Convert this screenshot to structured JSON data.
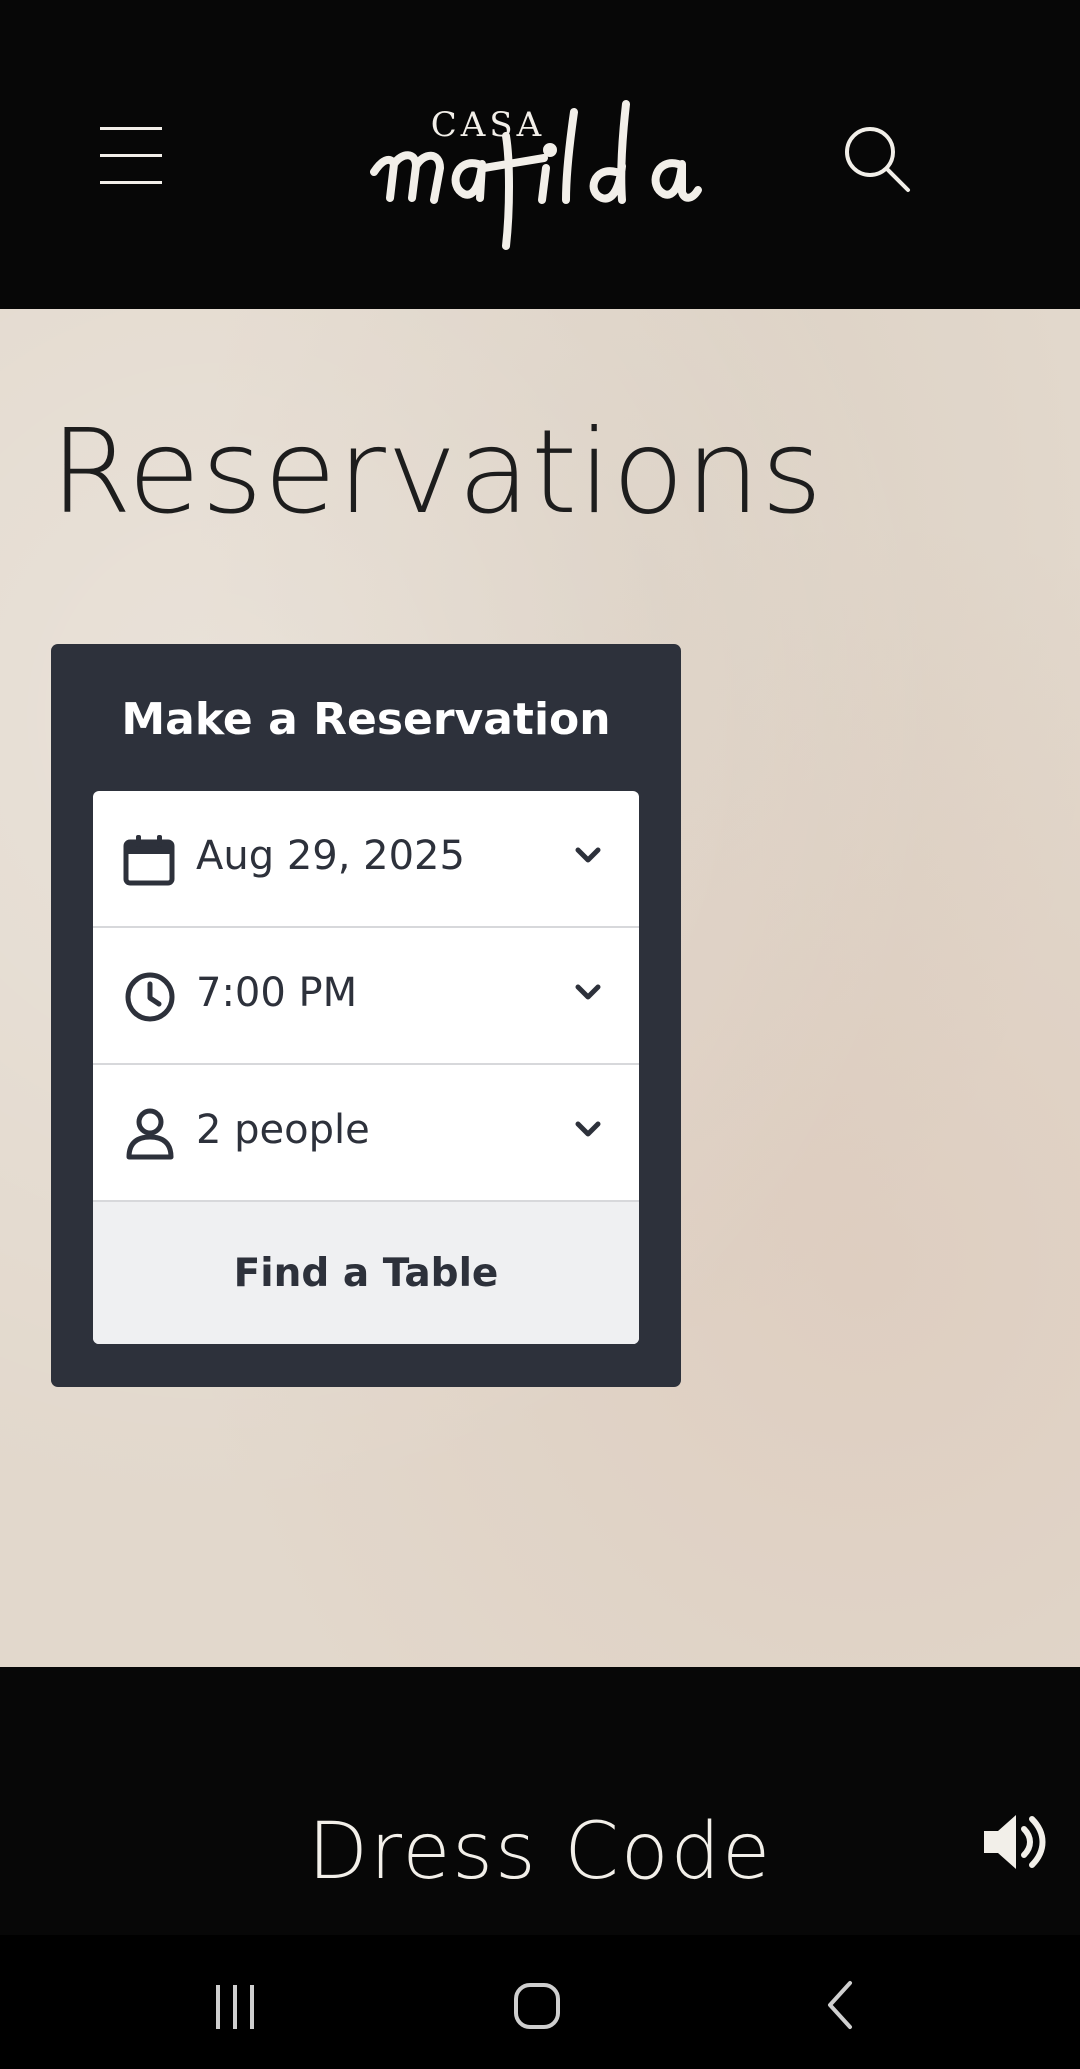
{
  "header": {
    "logo_top": "CASA",
    "logo_script": "matilda",
    "menu_icon": "hamburger-menu-icon",
    "search_icon": "search-icon"
  },
  "hero": {
    "title": "Reservations"
  },
  "reservation_card": {
    "title": "Make a Reservation",
    "date": {
      "value": "Aug 29, 2025",
      "icon": "calendar-icon"
    },
    "time": {
      "value": "7:00 PM",
      "icon": "clock-icon"
    },
    "party": {
      "value": "2 people",
      "icon": "person-icon"
    },
    "submit_label": "Find a Table"
  },
  "dress_code": {
    "title": "Dress Code",
    "sound_icon": "speaker-icon"
  },
  "system_nav": {
    "recents_icon": "recents-icon",
    "home_icon": "home-icon",
    "back_icon": "back-icon"
  },
  "colors": {
    "header_bg": "#070707",
    "card_bg": "#2d313b",
    "hero_bg": "#e2d8cc",
    "button_bg": "#eff0f2"
  }
}
